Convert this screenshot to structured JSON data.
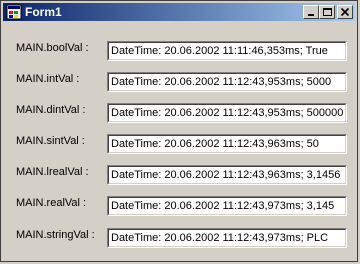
{
  "window": {
    "title": "Form1"
  },
  "rows": [
    {
      "label": "MAIN.boolVal :",
      "value": "DateTime: 20.06.2002 11:11:46,353ms; True"
    },
    {
      "label": "MAIN.intVal :",
      "value": "DateTime: 20.06.2002 11:12:43,953ms; 5000"
    },
    {
      "label": "MAIN.dintVal :",
      "value": "DateTime: 20.06.2002 11:12:43,953ms; 500000"
    },
    {
      "label": "MAIN.sintVal :",
      "value": "DateTime: 20.06.2002 11:12:43,963ms; 50"
    },
    {
      "label": "MAIN.lrealVal :",
      "value": "DateTime: 20.06.2002 11:12:43,963ms; 3,1456"
    },
    {
      "label": "MAIN.realVal :",
      "value": "DateTime: 20.06.2002 11:12:43,973ms; 3,145"
    },
    {
      "label": "MAIN.stringVal :",
      "value": "DateTime: 20.06.2002 11:12:43,973ms; PLC"
    }
  ],
  "icons": {
    "app": "form-app-icon",
    "minimize": "minimize-icon",
    "maximize": "maximize-icon",
    "close": "close-icon"
  }
}
